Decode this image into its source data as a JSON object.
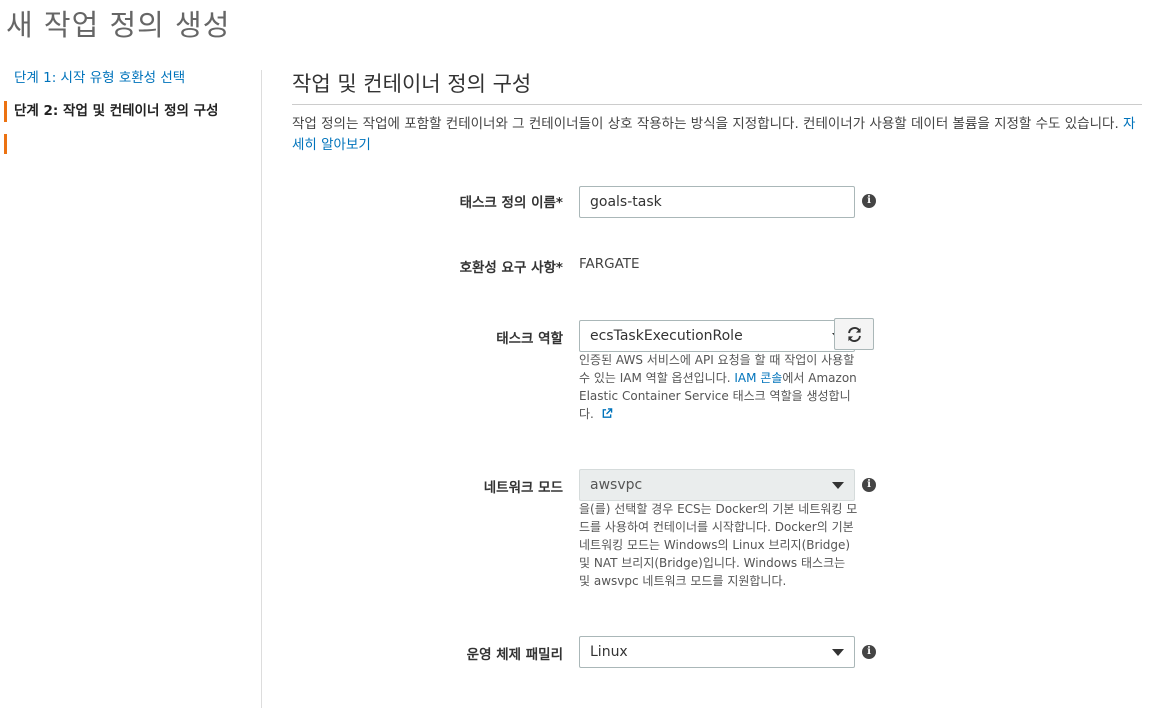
{
  "page": {
    "title": "새 작업 정의 생성"
  },
  "sidebar": {
    "steps": [
      {
        "label": "단계 1: 시작 유형 호환성 선택"
      },
      {
        "label": "단계 2: 작업 및 컨테이너 정의 구성"
      }
    ]
  },
  "section": {
    "title": "작업 및 컨테이너 정의 구성",
    "description": "작업 정의는 작업에 포함할 컨테이너와 그 컨테이너들이 상호 작용하는 방식을 지정합니다. 컨테이너가 사용할 데이터 볼륨을 지정할 수도 있습니다.",
    "learn_more": "자세히 알아보기"
  },
  "form": {
    "task_name": {
      "label": "태스크 정의 이름*",
      "value": "goals-task"
    },
    "compatibility": {
      "label": "호환성 요구 사항*",
      "value": "FARGATE"
    },
    "task_role": {
      "label": "태스크 역할",
      "value": "ecsTaskExecutionRole",
      "help_prefix": "인증된 AWS 서비스에 API 요청을 할 때 작업이 사용할 수 있는 IAM 역할 옵션입니다. ",
      "help_link": "IAM 콘솔",
      "help_suffix": "에서 Amazon Elastic Container Service 태스크 역할을 생성합니다."
    },
    "network_mode": {
      "label": "네트워크 모드",
      "value": "awsvpc",
      "help": "을(를) 선택할 경우 ECS는 Docker의 기본 네트워킹 모드를 사용하여 컨테이너를 시작합니다. Docker의 기본 네트워킹 모드는 Windows의 Linux 브리지(Bridge) 및 NAT 브리지(Bridge)입니다. Windows 태스크는 및 awsvpc 네트워크 모드를 지원합니다."
    },
    "os_family": {
      "label": "운영 체제 패밀리",
      "value": "Linux"
    }
  },
  "icons": {
    "info": "info-icon",
    "refresh": "refresh-icon",
    "external_link": "external-link-icon"
  },
  "colors": {
    "link": "#0073bb",
    "active_step_accent": "#ec7211"
  }
}
